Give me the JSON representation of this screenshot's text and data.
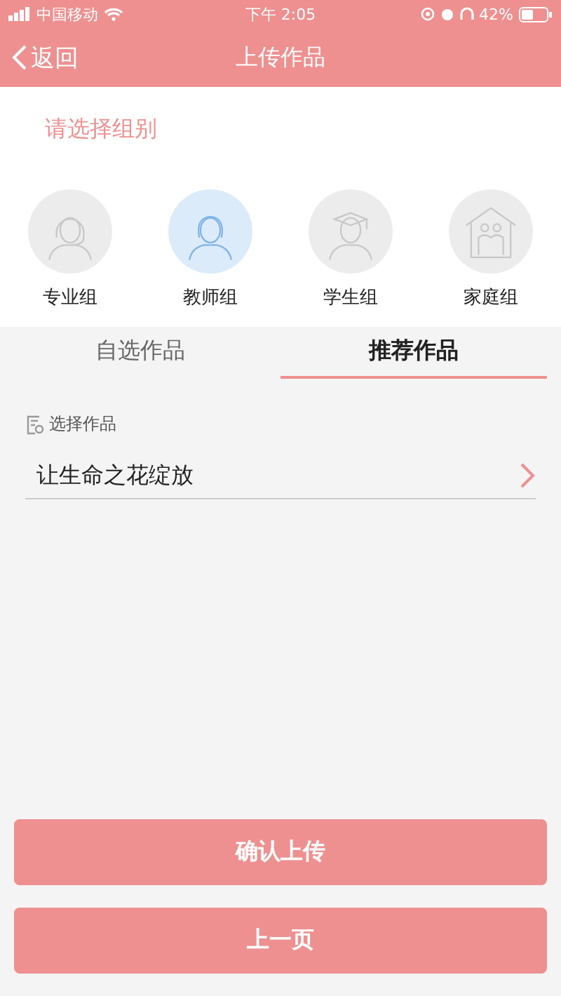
{
  "status_bar": {
    "carrier": "中国移动",
    "time": "下午 2:05",
    "battery": "42%"
  },
  "nav": {
    "back": "返回",
    "title": "上传作品"
  },
  "group_prompt": "请选择组别",
  "groups": [
    {
      "kind": "headset",
      "label": "专业组",
      "selected": false
    },
    {
      "kind": "teacher",
      "label": "教师组",
      "selected": true
    },
    {
      "kind": "graduate",
      "label": "学生组",
      "selected": false
    },
    {
      "kind": "family",
      "label": "家庭组",
      "selected": false
    }
  ],
  "tabs": [
    {
      "label": "自选作品",
      "selected": false
    },
    {
      "label": "推荐作品",
      "selected": true
    }
  ],
  "work_field": {
    "label": "选择作品",
    "value": "让生命之花绽放"
  },
  "buttons": [
    "确认上传",
    "上一页"
  ]
}
